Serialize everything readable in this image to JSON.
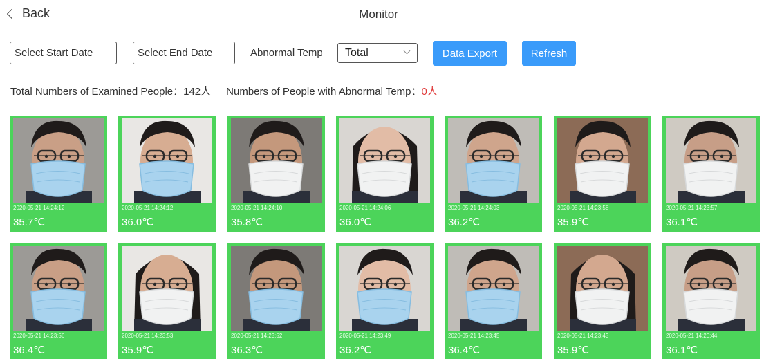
{
  "header": {
    "back_label": "Back",
    "title": "Monitor"
  },
  "filters": {
    "start_date_placeholder": "Select Start Date",
    "end_date_placeholder": "Select End Date",
    "abnormal_temp_label": "Abnormal Temp",
    "abnormal_temp_selected": "Total",
    "export_label": "Data Export",
    "refresh_label": "Refresh"
  },
  "stats": {
    "total_label": "Total Numbers of Examined People：",
    "total_value": "142人",
    "abnormal_label": "Numbers of People with Abnormal Temp：",
    "abnormal_value": "0人"
  },
  "colors": {
    "accent": "#3a9bfa",
    "card_green": "#4cd45a",
    "alert_red": "#e03a3a"
  },
  "records": [
    {
      "timestamp": "2020-05-21 14:24:12",
      "temperature": "35.7℃",
      "mask": "blue"
    },
    {
      "timestamp": "2020-05-21 14:24:12",
      "temperature": "36.0℃",
      "mask": "blue"
    },
    {
      "timestamp": "2020-05-21 14:24:10",
      "temperature": "35.8℃",
      "mask": "white"
    },
    {
      "timestamp": "2020-05-21 14:24:06",
      "temperature": "36.0℃",
      "mask": "white"
    },
    {
      "timestamp": "2020-05-21 14:24:03",
      "temperature": "36.2℃",
      "mask": "blue"
    },
    {
      "timestamp": "2020-05-21 14:23:58",
      "temperature": "35.9℃",
      "mask": "white"
    },
    {
      "timestamp": "2020-05-21 14:23:57",
      "temperature": "36.1℃",
      "mask": "white"
    },
    {
      "timestamp": "2020-05-21 14:23:56",
      "temperature": "36.4℃",
      "mask": "blue"
    },
    {
      "timestamp": "2020-05-21 14:23:53",
      "temperature": "35.9℃",
      "mask": "white"
    },
    {
      "timestamp": "2020-05-21 14:23:52",
      "temperature": "36.3℃",
      "mask": "blue"
    },
    {
      "timestamp": "2020-05-21 14:23:49",
      "temperature": "36.2℃",
      "mask": "blue"
    },
    {
      "timestamp": "2020-05-21 14:23:45",
      "temperature": "36.4℃",
      "mask": "blue"
    },
    {
      "timestamp": "2020-05-21 14:23:43",
      "temperature": "35.9℃",
      "mask": "white"
    },
    {
      "timestamp": "2020-05-21 14:20:44",
      "temperature": "36.1℃",
      "mask": "white"
    }
  ]
}
